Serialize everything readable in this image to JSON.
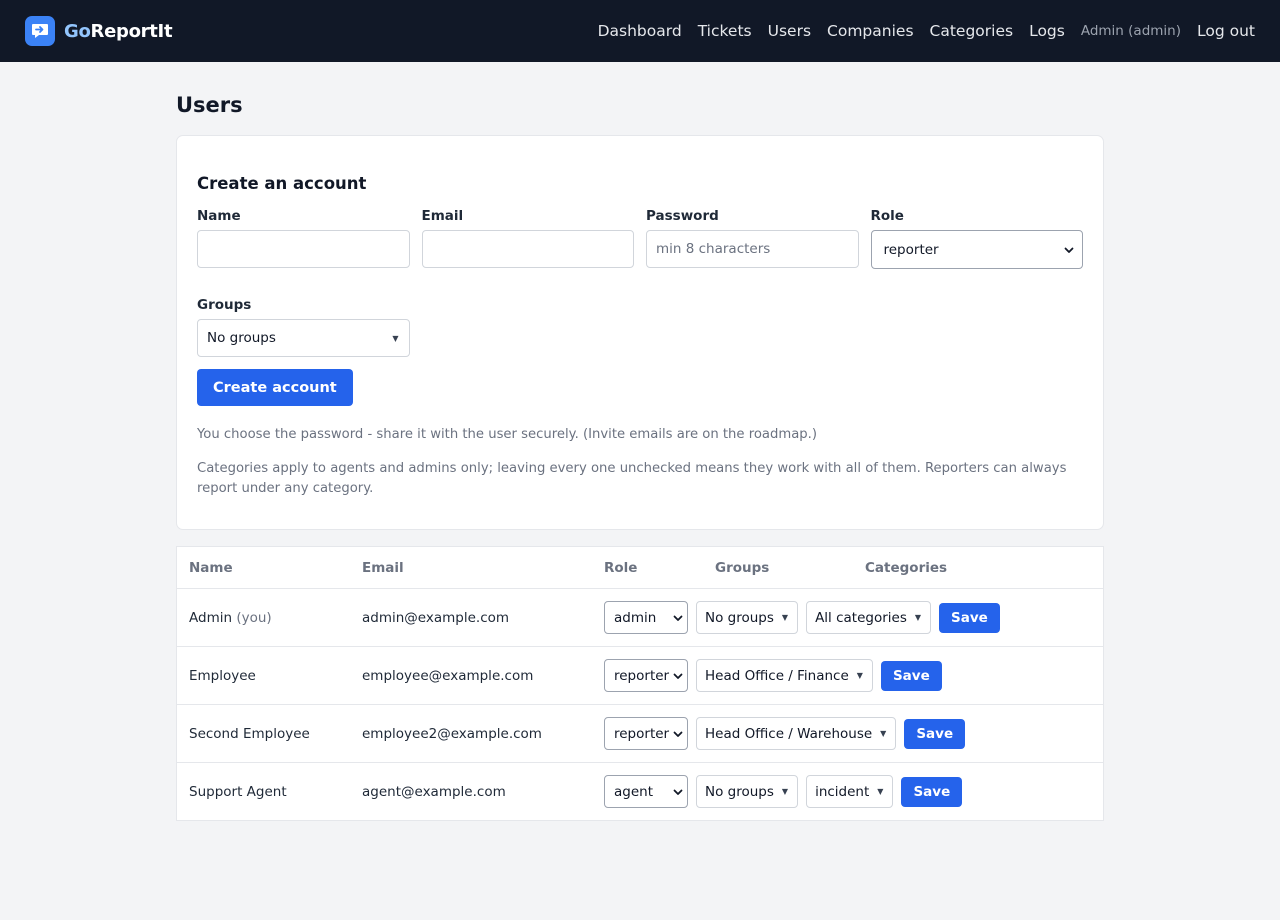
{
  "brand": {
    "prefix": "Go",
    "suffix": "ReportIt",
    "accent": "#3b82f6"
  },
  "nav": {
    "links": [
      "Dashboard",
      "Tickets",
      "Users",
      "Companies",
      "Categories",
      "Logs"
    ],
    "user": "Admin (admin)",
    "logout": "Log out"
  },
  "page": {
    "title": "Users"
  },
  "create": {
    "title": "Create an account",
    "name_label": "Name",
    "email_label": "Email",
    "password_label": "Password",
    "password_placeholder": "min 8 characters",
    "role_label": "Role",
    "role_value": "reporter",
    "groups_label": "Groups",
    "groups_value": "No groups",
    "button": "Create account",
    "help1": "You choose the password - share it with the user securely. (Invite emails are on the roadmap.)",
    "help2": "Categories apply to agents and admins only; leaving every one unchecked means they work with all of them. Reporters can always report under any category."
  },
  "table": {
    "headers": {
      "name": "Name",
      "email": "Email",
      "role": "Role",
      "groups": "Groups",
      "categories": "Categories"
    },
    "rows": [
      {
        "name": "Admin",
        "note": "(you)",
        "email": "admin@example.com",
        "role": "admin",
        "groups": "No groups",
        "categories": "All categories",
        "save": "Save"
      },
      {
        "name": "Employee",
        "note": "",
        "email": "employee@example.com",
        "role": "reporter",
        "groups": "Head Office / Finance",
        "categories": "",
        "save": "Save"
      },
      {
        "name": "Second Employee",
        "note": "",
        "email": "employee2@example.com",
        "role": "reporter",
        "groups": "Head Office / Warehouse",
        "categories": "",
        "save": "Save"
      },
      {
        "name": "Support Agent",
        "note": "",
        "email": "agent@example.com",
        "role": "agent",
        "groups": "No groups",
        "categories": "incident",
        "save": "Save"
      }
    ]
  }
}
